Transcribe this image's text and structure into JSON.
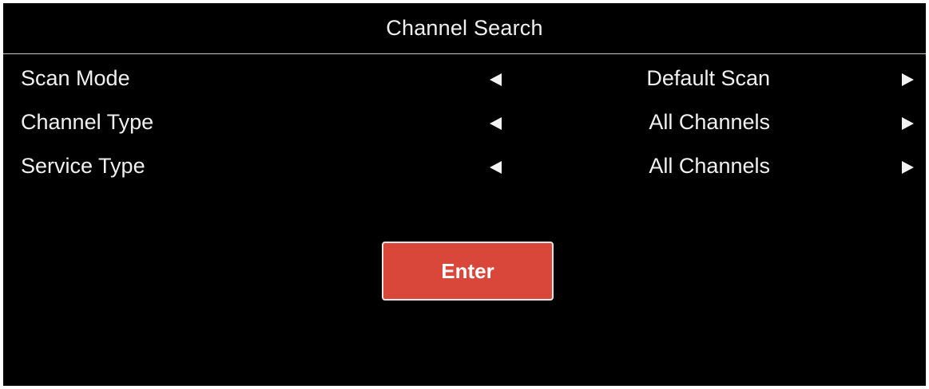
{
  "header": {
    "title": "Channel Search"
  },
  "settings": [
    {
      "label": "Scan Mode",
      "value": "Default Scan"
    },
    {
      "label": "Channel Type",
      "value": "All Channels"
    },
    {
      "label": "Service Type",
      "value": "All Channels"
    }
  ],
  "enter_button": {
    "label": "Enter",
    "color": "#d9473a"
  },
  "icons": {
    "left": "triangle-left-icon",
    "right": "triangle-right-icon"
  },
  "colors": {
    "background": "#000000",
    "text": "#f0f0f0",
    "divider": "#c8c8c8"
  }
}
